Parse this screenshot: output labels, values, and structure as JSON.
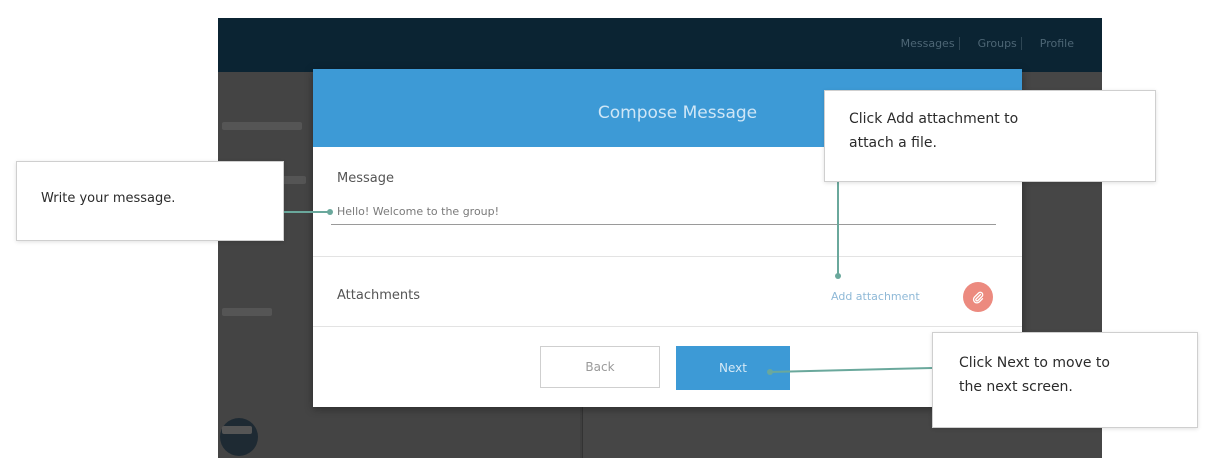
{
  "app": {
    "nav_items": [
      "Messages",
      "Groups",
      "Profile"
    ]
  },
  "modal": {
    "title": "Compose Message",
    "message_label": "Message",
    "message_value": "Hello! Welcome to the group!",
    "attachments_label": "Attachments",
    "add_attachment_label": "Add attachment",
    "attach_icon": "paperclip-icon",
    "back_label": "Back",
    "next_label": "Next"
  },
  "callouts": {
    "write_message": "Write your message.",
    "add_attachment_line1": "Click Add attachment to",
    "add_attachment_line2": "attach a file.",
    "next_line1": "Click Next to move to",
    "next_line2": "the next screen."
  },
  "colors": {
    "accent": "#3d9ad6",
    "attach_button": "#ec8a7f",
    "connector": "#6aa89c",
    "header_dark": "#0b2433"
  }
}
